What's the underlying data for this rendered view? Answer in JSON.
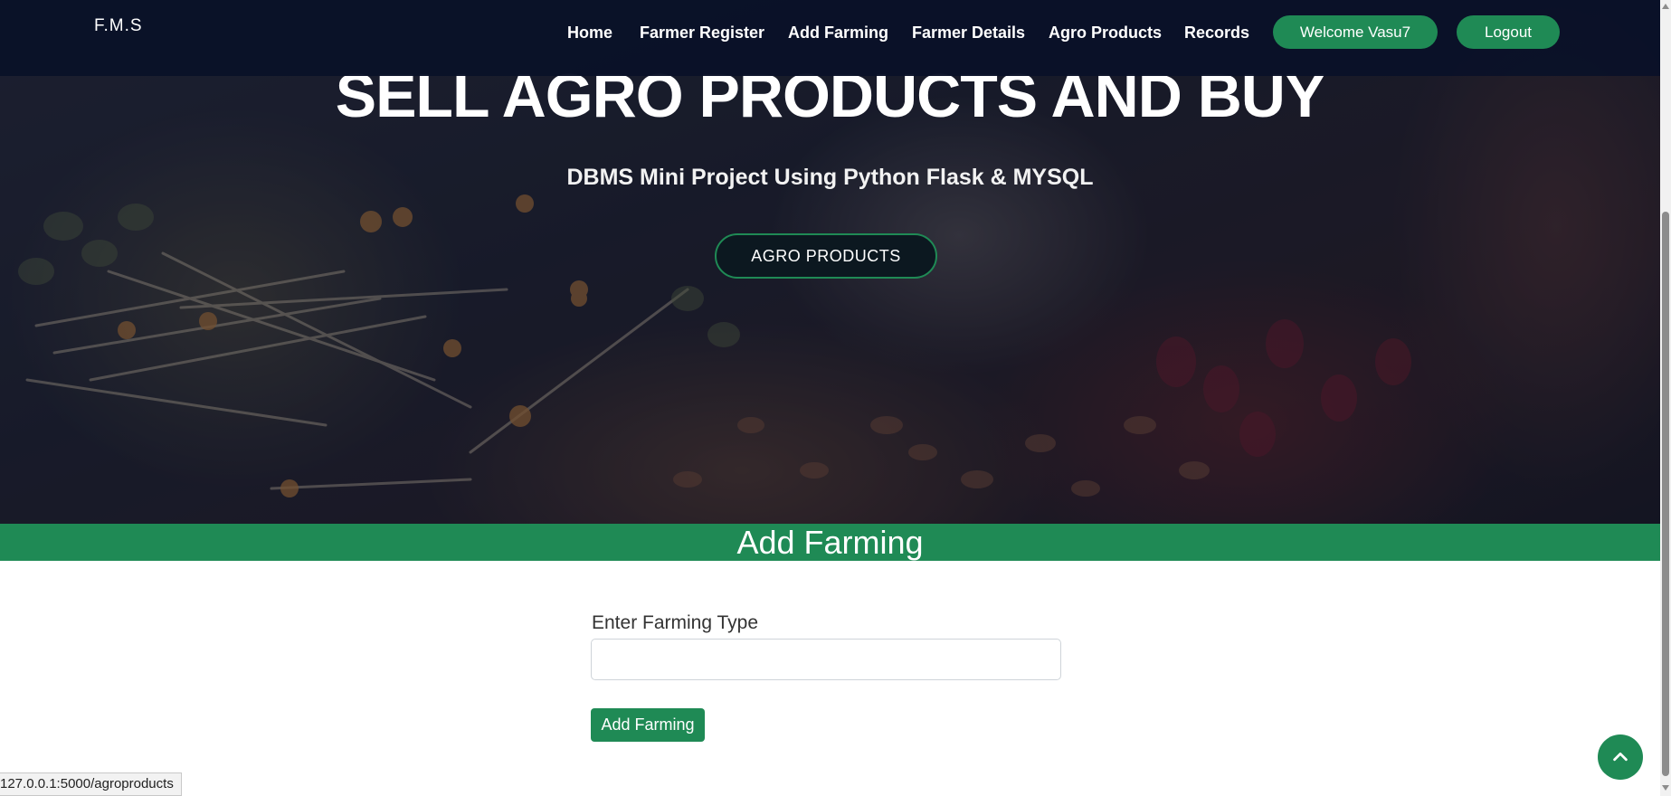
{
  "navbar": {
    "brand": "F.M.S",
    "links": [
      "Home",
      "Farmer Register",
      "Add Farming",
      "Farmer Details",
      "Agro Products",
      "Records"
    ],
    "welcome_label": "Welcome Vasu7",
    "logout_label": "Logout"
  },
  "hero": {
    "title": "SELL AGRO PRODUCTS AND BUY",
    "subtitle": "DBMS Mini Project Using Python Flask & MYSQL",
    "button_label": "AGRO PRODUCTS"
  },
  "section": {
    "title": "Add Farming"
  },
  "form": {
    "label": "Enter Farming Type",
    "input_value": "",
    "submit_label": "Add Farming"
  },
  "status_bar": {
    "url": "127.0.0.1:5000/agroproducts"
  },
  "icons": {
    "back_to_top": "chevron-up-icon"
  },
  "colors": {
    "accent": "#1f8a55",
    "navbar": "#0a1228"
  }
}
